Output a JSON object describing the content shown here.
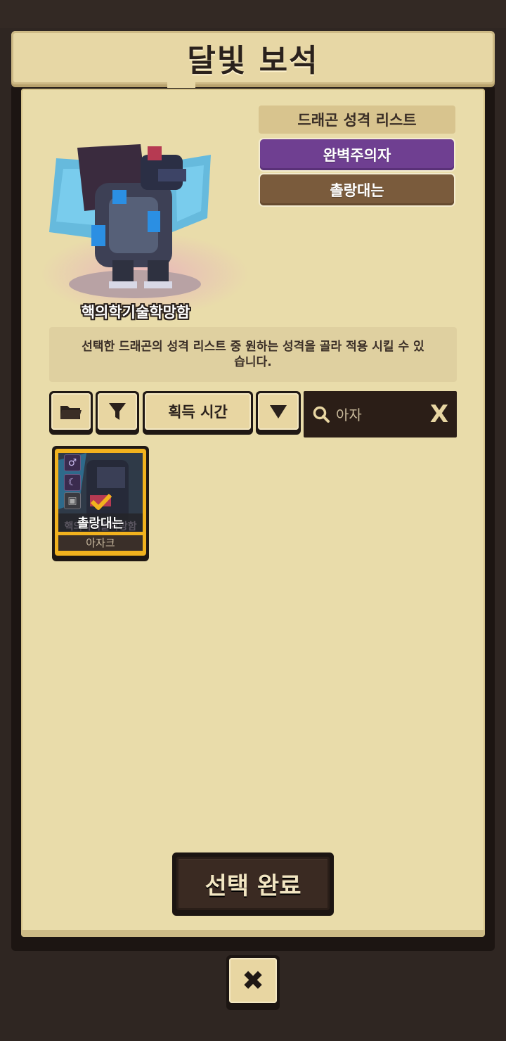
{
  "title": "달빛 보석",
  "dragon": {
    "name": "핵의학기술학망함"
  },
  "personality_list": {
    "header": "드래곤 성격 리스트",
    "items": [
      {
        "label": "완벽주의자",
        "color": "#6f3f91"
      },
      {
        "label": "촐랑대는",
        "color": "#7a5b3c"
      }
    ]
  },
  "description": "선택한 드래곤의 성격 리스트 중 원하는 성격을 골라 적용 시킬 수 있습니다.",
  "toolbar": {
    "folder_icon": "folder-icon",
    "filter_icon": "filter-icon",
    "sort_label": "획득 시간",
    "sort_order_icon": "triangle-down-icon",
    "search": {
      "value": "아자",
      "clear_label": "X"
    }
  },
  "cards": [
    {
      "name_behind": "핵의학기술학망함",
      "personality": "촐랑대는",
      "owner": "아자크",
      "badges": [
        "male-icon",
        "moon-icon",
        "robot-icon"
      ],
      "selected": true
    }
  ],
  "confirm_label": "선택 완료",
  "close_label": "✖",
  "colors": {
    "accent_gold": "#f1b21e",
    "panel": "#e9dcaa",
    "background": "#2f2622"
  }
}
